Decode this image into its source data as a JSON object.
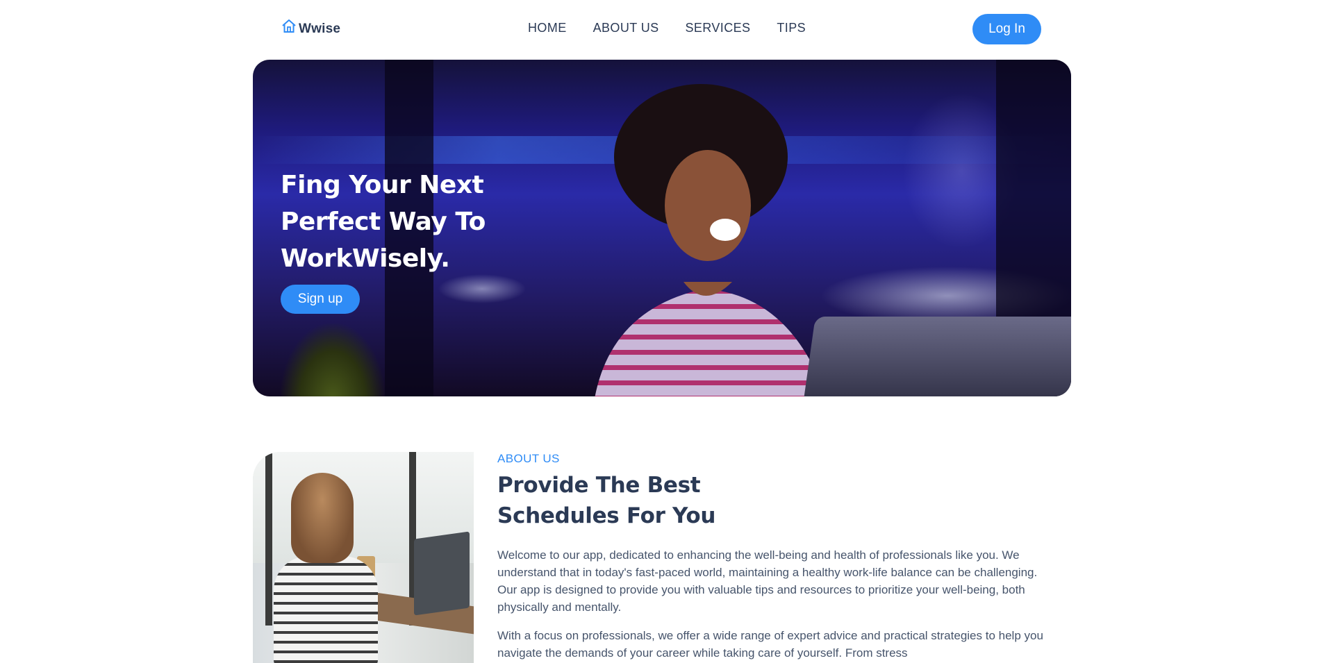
{
  "nav": {
    "logo_text": "Wwise",
    "links": [
      "HOME",
      "ABOUT US",
      "SERVICES",
      "TIPS"
    ],
    "login_label": "Log In"
  },
  "hero": {
    "title_lines": [
      "Fing Your Next",
      "Perfect Way To",
      "WorkWisely."
    ],
    "signup_label": "Sign up"
  },
  "about": {
    "label": "ABOUT US",
    "title_lines": [
      "Provide The Best",
      "Schedules For You"
    ],
    "paragraphs": [
      "Welcome to our app, dedicated to enhancing the well-being and health of professionals like you. We understand that in today's fast-paced world, maintaining a healthy work-life balance can be challenging. Our app is designed to provide you with valuable tips and resources to prioritize your well-being, both physically and mentally.",
      "With a focus on professionals, we offer a wide range of expert advice and practical strategies to help you navigate the demands of your career while taking care of yourself. From stress"
    ]
  },
  "colors": {
    "accent": "#2f8cf6",
    "text_dark": "#2b3a55",
    "text_body": "#46546b"
  },
  "icons": {
    "logo": "home-icon"
  }
}
